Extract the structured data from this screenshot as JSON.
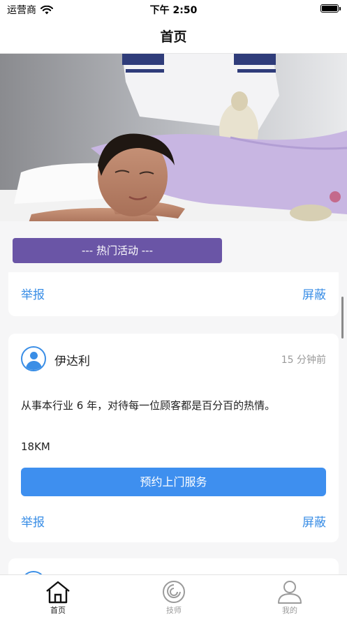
{
  "status_bar": {
    "carrier": "运营商",
    "time": "下午 2:50",
    "battery_level": 1.0
  },
  "nav": {
    "title": "首页"
  },
  "section": {
    "title": "--- 热门活动 ---"
  },
  "cards": [
    {
      "report_label": "举报",
      "block_label": "屏蔽"
    },
    {
      "name": "伊达利",
      "time_ago": "15 分钟前",
      "description": "从事本行业 6 年，对待每一位顾客都是百分百的热情。",
      "distance": "18KM",
      "book_label": "预约上门服务",
      "report_label": "举报",
      "block_label": "屏蔽"
    }
  ],
  "tabs": [
    {
      "label": "首页",
      "icon": "home-icon",
      "active": true
    },
    {
      "label": "技师",
      "icon": "technician-icon",
      "active": false
    },
    {
      "label": "我的",
      "icon": "profile-icon",
      "active": false
    }
  ],
  "colors": {
    "accent": "#3e8fef",
    "section_bar": "#6a55a6",
    "link": "#3a8ee6"
  }
}
